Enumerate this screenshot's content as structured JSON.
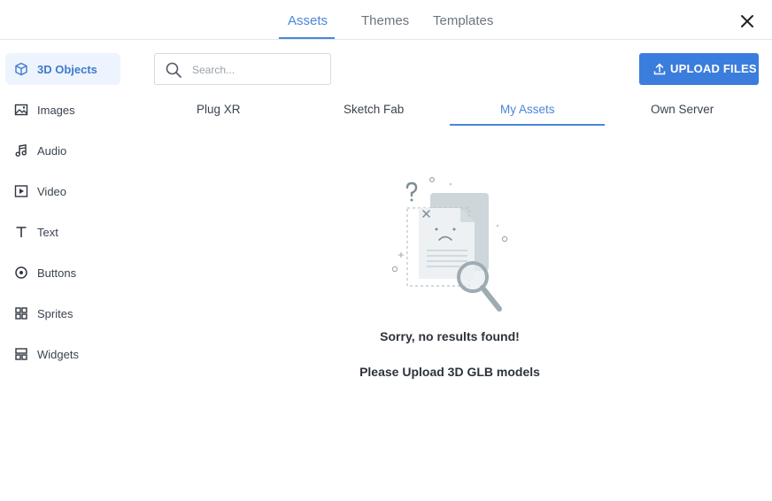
{
  "top_tabs": [
    {
      "label": "Assets",
      "active": true
    },
    {
      "label": "Themes",
      "active": false
    },
    {
      "label": "Templates",
      "active": false
    }
  ],
  "sidebar": {
    "items": [
      {
        "label": "3D Objects",
        "icon": "cube-icon",
        "active": true
      },
      {
        "label": "Images",
        "icon": "image-icon",
        "active": false
      },
      {
        "label": "Audio",
        "icon": "music-icon",
        "active": false
      },
      {
        "label": "Video",
        "icon": "video-icon",
        "active": false
      },
      {
        "label": "Text",
        "icon": "text-icon",
        "active": false
      },
      {
        "label": "Buttons",
        "icon": "button-icon",
        "active": false
      },
      {
        "label": "Sprites",
        "icon": "sprites-icon",
        "active": false
      },
      {
        "label": "Widgets",
        "icon": "widgets-icon",
        "active": false
      }
    ]
  },
  "search": {
    "placeholder": "Search...",
    "value": ""
  },
  "upload": {
    "label": "UPLOAD FILES"
  },
  "sub_tabs": [
    {
      "label": "Plug XR",
      "active": false
    },
    {
      "label": "Sketch Fab",
      "active": false
    },
    {
      "label": "My Assets",
      "active": true
    },
    {
      "label": "Own Server",
      "active": false
    }
  ],
  "empty_state": {
    "title": "Sorry, no results found!",
    "subtitle": "Please Upload 3D GLB models"
  },
  "colors": {
    "accent": "#3b7ddd",
    "active_bg": "#eef4fd"
  }
}
